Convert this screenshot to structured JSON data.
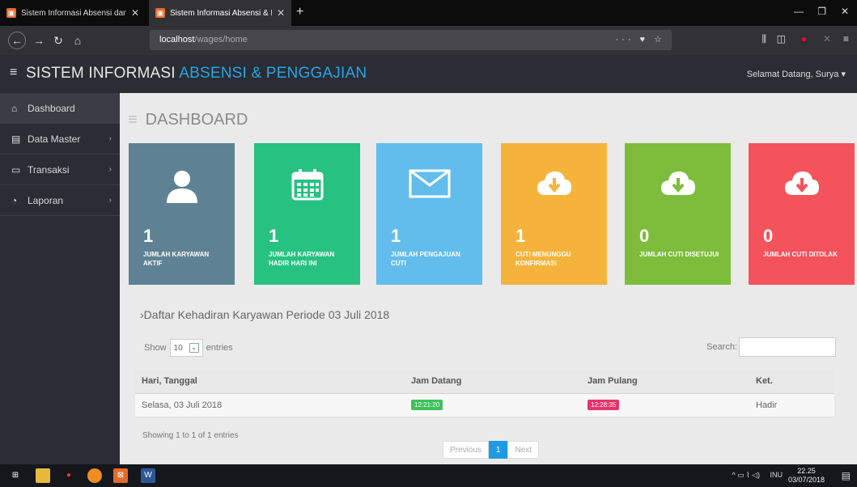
{
  "browser": {
    "tabs": [
      {
        "title": "Sistem Informasi Absensi dan P"
      },
      {
        "title": "Sistem Informasi Absensi & Per"
      }
    ],
    "new_tab": "+",
    "url_host": "localhost",
    "url_path": "/wages/home",
    "url_actions": "··· ♥ ☆",
    "window_controls": {
      "minimize": "—",
      "restore": "❐",
      "close": "✕"
    }
  },
  "app": {
    "title_plain": "SISTEM INFORMASI ",
    "title_highlight": "ABSENSI & PENGGAJIAN",
    "greeting": "Selamat Datang, Surya ▾",
    "menu_icon": "≡"
  },
  "sidebar": {
    "items": [
      {
        "label": "Dashboard",
        "icon": "⌂",
        "arrow": ""
      },
      {
        "label": "Data Master",
        "icon": "▤",
        "arrow": "›"
      },
      {
        "label": "Transaksi",
        "icon": "▭",
        "arrow": "›"
      },
      {
        "label": "Laporan",
        "icon": "◔",
        "arrow": "›"
      }
    ]
  },
  "page": {
    "title": "DASHBOARD",
    "icon": "≡"
  },
  "cards": [
    {
      "value": "1",
      "label": "JUMLAH KARYAWAN AKTIF",
      "color": "#5e8294",
      "icon": "user-icon"
    },
    {
      "value": "1",
      "label": "JUMLAH KARYAWAN HADIR HARI INI",
      "color": "#27c281",
      "icon": "calendar-icon"
    },
    {
      "value": "1",
      "label": "JUMLAH PENGAJUAN CUTI",
      "color": "#63bdec",
      "icon": "envelope-icon"
    },
    {
      "value": "1",
      "label": "CUTI MENUNGGU KONFIRMASI",
      "color": "#f6b33b",
      "icon": "cloud-download-icon"
    },
    {
      "value": "0",
      "label": "JUMLAH CUTI DISETUJUI",
      "color": "#7dbd3b",
      "icon": "cloud-download-icon"
    },
    {
      "value": "0",
      "label": "JUMLAH CUTI DITOLAK",
      "color": "#f5535b",
      "icon": "cloud-download-icon"
    }
  ],
  "attendance": {
    "heading": "Daftar Kehadiran Karyawan Periode 03 Juli 2018",
    "show_label": "Show",
    "show_value": "10",
    "entries_label": "entries",
    "search_label": "Search:",
    "columns": [
      "Hari, Tanggal",
      "Jam Datang",
      "Jam Pulang",
      "Ket."
    ],
    "rows": [
      {
        "date": "Selasa, 03 Juli 2018",
        "in": "12:21:20",
        "out": "12:28:35",
        "status": "Hadir"
      }
    ],
    "info": "Showing 1 to 1 of 1 entries",
    "pager": {
      "prev": "Previous",
      "current": "1",
      "next": "Next"
    },
    "badge_colors": {
      "in": "#3ec15c",
      "out": "#e8336a"
    }
  },
  "taskbar": {
    "lang": "INU",
    "time": "22.25",
    "date": "03/07/2018"
  }
}
